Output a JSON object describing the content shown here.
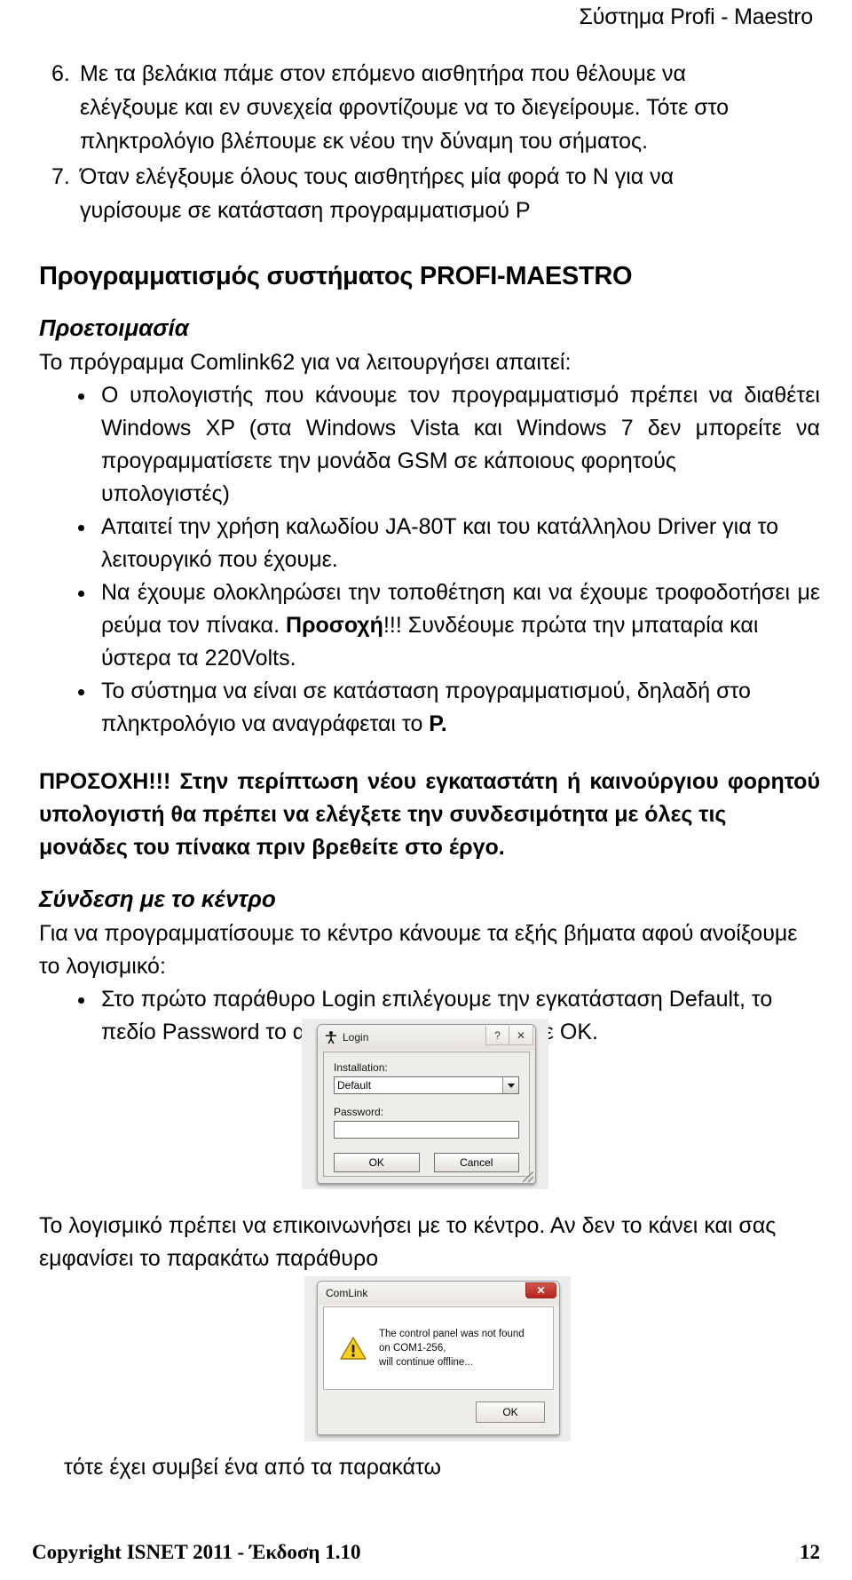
{
  "header": {
    "title": "Σύστημα Profi - Maestro"
  },
  "numbered_list": [
    {
      "marker": "6.",
      "lines": [
        "Με τα βελάκια πάμε στον επόμενο αισθητήρα που θέλουμε να",
        "ελέγξουμε και εν συνεχεία φροντίζουμε να το διεγείρουμε. Τότε στο",
        "πληκτρολόγιο βλέπουμε εκ νέου την δύναμη του σήματος."
      ]
    },
    {
      "marker": "7.",
      "lines": [
        "Όταν ελέγξουμε όλους τους αισθητήρες μία φορά το Ν για να",
        "γυρίσουμε σε κατάσταση προγραμματισμού Ρ"
      ]
    }
  ],
  "section_title": "Προγραμματισμός συστήματος PROFI-MAESTRO",
  "prep": {
    "sub_title": "Προετοιμασία",
    "intro": "Το πρόγραμμα Comlink62 για να λειτουργήσει απαιτεί:",
    "bullets": [
      {
        "lines": [
          "Ο υπολογιστής που κάνουμε τον προγραμματισμό πρέπει να διαθέτει",
          "Windows XP (στα Windows Vista και Windows 7 δεν μπορείτε να",
          "προγραμματίσετε την μονάδα GSM σε κάποιους φορητούς",
          "υπολογιστές)"
        ]
      },
      {
        "lines": [
          "Απαιτεί την χρήση καλωδίου JA-80T και του κατάλληλου Driver για το",
          "λειτουργικό που έχουμε."
        ]
      },
      {
        "line1": "Να έχουμε ολοκληρώσει την τοποθέτηση και να έχουμε τροφοδοτήσει",
        "line2_a": "με ρεύμα τον πίνακα. ",
        "line2_b": "Προσοχή",
        "line2_c": "!!! Συνδέουμε πρώτα την μπαταρία και",
        "line3": "ύστερα τα 220Volts."
      },
      {
        "line1": "Το σύστημα να είναι σε κατάσταση προγραμματισμού, δηλαδή στο",
        "line2_a": "πληκτρολόγιο να αναγράφεται το ",
        "line2_b": "Ρ."
      }
    ]
  },
  "warning": {
    "lines": [
      "ΠΡΟΣΟΧΗ!!! Στην περίπτωση νέου εγκαταστάτη ή καινούργιου φορητού",
      "υπολογιστή θα πρέπει να ελέγξετε την συνδεσιμότητα με όλες τις",
      "μονάδες του πίνακα πριν βρεθείτε στο έργο."
    ]
  },
  "connection": {
    "sub_title": "Σύνδεση με το κέντρο",
    "intro_lines": [
      "Για να προγραμματίσουμε το κέντρο κάνουμε τα εξής βήματα αφού ανοίξουμε",
      "το λογισμικό:"
    ],
    "bullet_lines": [
      "Στο πρώτο παράθυρο Login επιλέγουμε την εγκατάσταση Default, το",
      "πεδίο Password το αφήνουμε κενό και πατάμε ΟΚ."
    ]
  },
  "login_dialog": {
    "icon": "person-icon",
    "title": "Login",
    "help_button": "?",
    "close_button": "✕",
    "installation_label": "Installation:",
    "installation_value": "Default",
    "password_label": "Password:",
    "password_value": "",
    "ok_label": "OK",
    "cancel_label": "Cancel"
  },
  "mid_text": {
    "lines": [
      "Το λογισμικό πρέπει να επικοινωνήσει με το κέντρο. Αν δεν το κάνει και",
      "σας εμφανίσει το παρακάτω παράθυρο"
    ]
  },
  "comlink_dialog": {
    "title": "ComLink",
    "close_button": "✕",
    "close_color": "#bd2a21",
    "icon": "warning-triangle-icon",
    "icon_color": "#f5c518",
    "message_lines": [
      "The control panel was not found",
      "on COM1-256,",
      "will continue offline..."
    ],
    "ok_label": "OK"
  },
  "tail_text": "τότε έχει συμβεί ένα από τα παρακάτω",
  "footer": {
    "copyright": "Copyright ISNET 2011 - Έκδοση 1.10",
    "page_number": "12"
  }
}
